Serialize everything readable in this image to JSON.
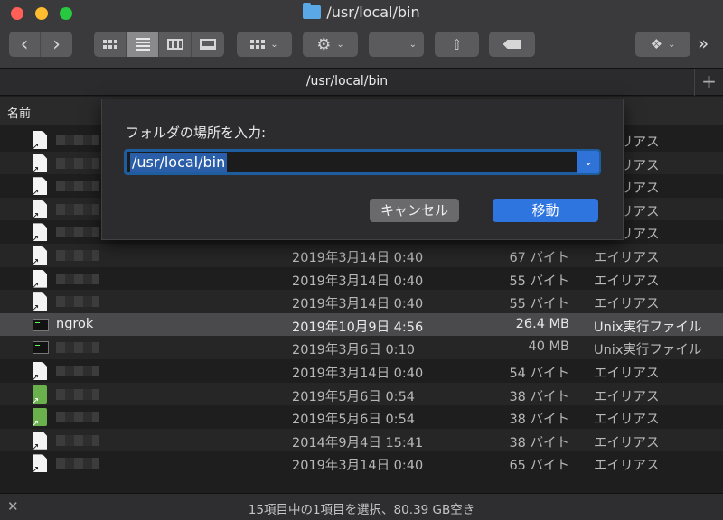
{
  "window": {
    "title": "/usr/local/bin"
  },
  "toolbar": {
    "back": "‹",
    "forward": "›",
    "more": "»"
  },
  "pathbar": {
    "label": "/usr/local/bin",
    "plus": "+"
  },
  "table": {
    "name_header": "名前"
  },
  "rows": [
    {
      "name": "",
      "date": "",
      "size": "",
      "kind": "エイリアス",
      "icon": "alias"
    },
    {
      "name": "",
      "date": "",
      "size": "",
      "kind": "エイリアス",
      "icon": "alias"
    },
    {
      "name": "",
      "date": "",
      "size": "",
      "kind": "エイリアス",
      "icon": "alias"
    },
    {
      "name": "",
      "date": "",
      "size": "",
      "kind": "エイリアス",
      "icon": "alias"
    },
    {
      "name": "",
      "date": "",
      "size": "",
      "kind": "エイリアス",
      "icon": "alias"
    },
    {
      "name": "",
      "date": "2019年3月14日 0:40",
      "size": "67 バイト",
      "kind": "エイリアス",
      "icon": "alias"
    },
    {
      "name": "",
      "date": "2019年3月14日 0:40",
      "size": "55 バイト",
      "kind": "エイリアス",
      "icon": "alias"
    },
    {
      "name": "",
      "date": "2019年3月14日 0:40",
      "size": "55 バイト",
      "kind": "エイリアス",
      "icon": "alias"
    },
    {
      "name": "ngrok",
      "date": "2019年10月9日 4:56",
      "size": "26.4 MB",
      "kind": "Unix実行ファイル",
      "icon": "exec"
    },
    {
      "name": "",
      "date": "2019年3月6日 0:10",
      "size": "40 MB",
      "kind": "Unix実行ファイル",
      "icon": "exec"
    },
    {
      "name": "",
      "date": "2019年3月14日 0:40",
      "size": "54 バイト",
      "kind": "エイリアス",
      "icon": "alias"
    },
    {
      "name": "",
      "date": "2019年5月6日 0:54",
      "size": "38 バイト",
      "kind": "エイリアス",
      "icon": "green"
    },
    {
      "name": "",
      "date": "2019年5月6日 0:54",
      "size": "38 バイト",
      "kind": "エイリアス",
      "icon": "green"
    },
    {
      "name": "",
      "date": "2014年9月4日 15:41",
      "size": "38 バイト",
      "kind": "エイリアス",
      "icon": "alias"
    },
    {
      "name": "",
      "date": "2019年3月14日 0:40",
      "size": "65 バイト",
      "kind": "エイリアス",
      "icon": "alias"
    }
  ],
  "dialog": {
    "prompt": "フォルダの場所を入力:",
    "value": "/usr/local/bin",
    "cancel_label": "キャンセル",
    "go_label": "移動"
  },
  "status": {
    "text": "15項目中の1項目を選択、80.39 GB空き"
  },
  "colors": {
    "accent": "#2f75e0",
    "selection": "#4a4a4c"
  }
}
